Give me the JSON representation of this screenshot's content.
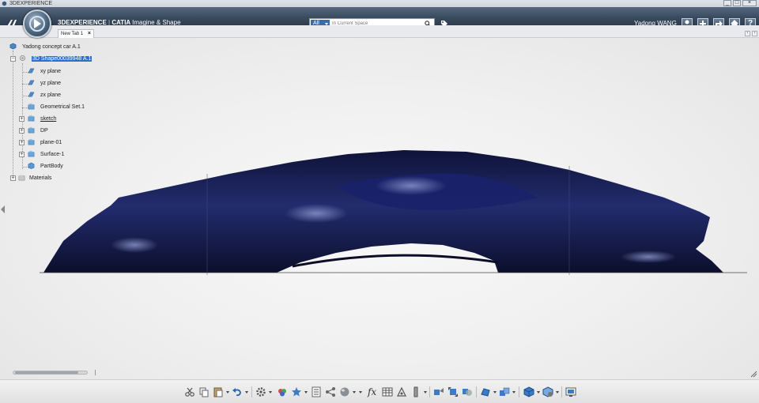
{
  "window": {
    "title": "3DEXPERIENCE",
    "controls": [
      "_",
      "□",
      "×"
    ]
  },
  "header": {
    "brand_product": "3DEXPERIENCE",
    "brand_separator": "|",
    "brand_app_bold": "CATIA",
    "brand_app": "Imagine & Shape",
    "search": {
      "scope": "All",
      "placeholder": "In Current Space"
    },
    "user": "Yadong WANG",
    "buttons": [
      "user-icon",
      "plus-icon",
      "share-icon",
      "home-icon",
      "help-icon"
    ],
    "help_label": "?"
  },
  "tabs": [
    {
      "label": "New Tab 1",
      "close": "×"
    }
  ],
  "tree": {
    "root": "Yadong concept car A.1",
    "shape": "3D Shape00039948 A.1",
    "children": [
      "xy plane",
      "yz plane",
      "zx plane",
      "Geometrical Set.1",
      "sketch",
      "DP",
      "plane-01",
      "Surface-1",
      "PartBody"
    ],
    "materials": "Materials",
    "expand_symbol": "+",
    "collapse_symbol": "−"
  },
  "colors": {
    "topbar": "#3b4c60",
    "selection": "#2f6ed1",
    "car_body": "#1a2257"
  },
  "toolbar": {
    "icons": [
      "cut-icon",
      "copy-icon",
      "paste-icon",
      "undo-icon",
      "settings-icon",
      "materials-icon",
      "favorite-icon",
      "list-icon",
      "graph-icon",
      "render-icon",
      "formula-icon",
      "table-icon",
      "measure-icon",
      "probe-icon",
      "compass-tool-icon",
      "transform-icon",
      "boolean-icon",
      "shape-icon",
      "group-icon",
      "cube-icon",
      "view-icon",
      "capture-icon"
    ],
    "formula_label": "fx"
  }
}
